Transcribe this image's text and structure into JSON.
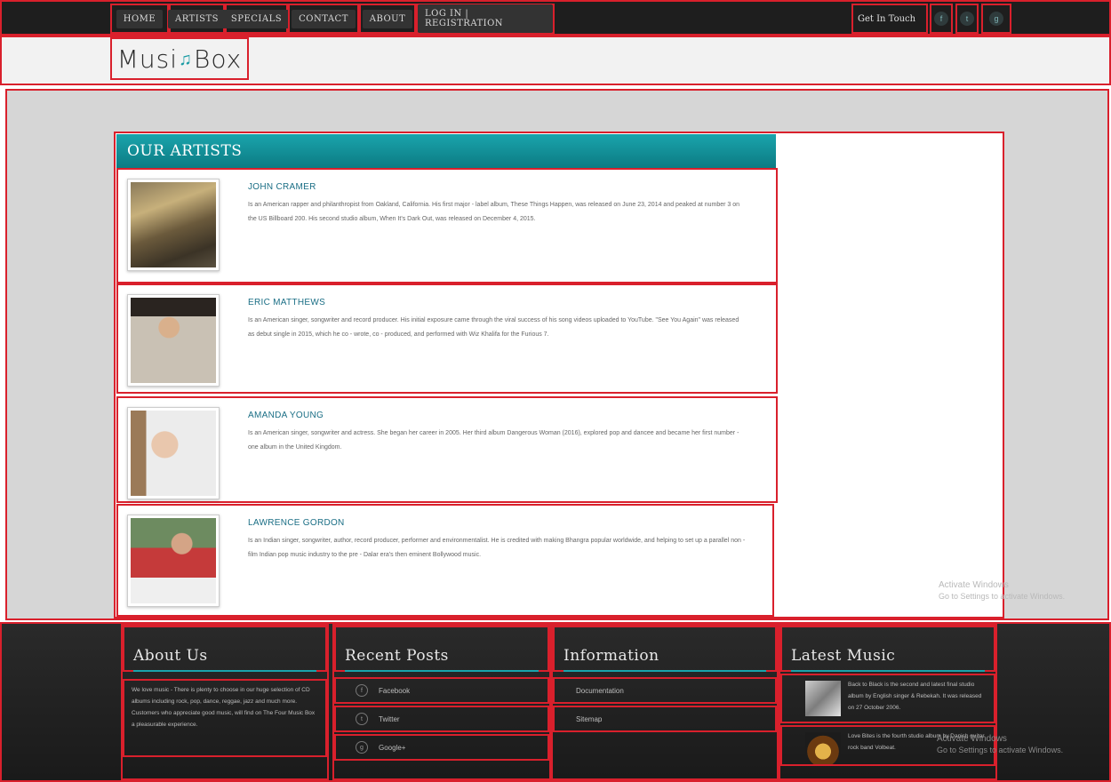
{
  "nav": {
    "items": [
      "Home",
      "Artists",
      "Specials",
      "Contact",
      "About",
      "Log In | Registration"
    ],
    "get_in_touch": "Get In Touch",
    "social_icons": [
      "facebook-icon",
      "twitter-icon",
      "google-plus-icon"
    ],
    "social_glyphs": [
      "f",
      "t",
      "g"
    ]
  },
  "logo": {
    "part1": "Musi",
    "note": "♫",
    "part2": "Box"
  },
  "artists_section": {
    "title": "Our Artists",
    "artists": [
      {
        "name": "JOHN CRAMER",
        "bio": "Is an American rapper and philanthropist from Oakland, California. His first major - label album, These Things Happen, was released on June 23, 2014 and peaked at number 3 on the US Billboard 200. His second studio album, When It's Dark Out, was released on December 4, 2015."
      },
      {
        "name": "ERIC MATTHEWS",
        "bio": "Is an American singer, songwriter and record producer. His initial exposure came through the viral success of his song videos uploaded to YouTube. \"See You Again\" was released as debut single in 2015, which he co - wrote, co - produced, and performed with Wiz Khalifa for the Furious 7."
      },
      {
        "name": "AMANDA YOUNG",
        "bio": "Is an American singer, songwriter and actress. She began her career in 2005. Her third album Dangerous Woman (2016), explored pop and dancee and became her first number - one album in the United Kingdom."
      },
      {
        "name": "LAWRENCE GORDON",
        "bio": "Is an Indian singer, songwriter, author, record producer, performer and environmentalist. He is credited with making Bhangra popular worldwide, and helping to set up a parallel non - film Indian pop music industry to the pre - Dalar era's then eminent Bollywood music."
      }
    ]
  },
  "watermark": {
    "line1": "Activate Windows",
    "line2": "Go to Settings to activate Windows."
  },
  "footer": {
    "about": {
      "title": "About Us",
      "text": "We love music - There is plenty to choose in our huge selection of CD albums including rock, pop, dance, reggae, jazz and much more. Customers who appreciate good music, will find on The Four Music Box a pleasurable experience."
    },
    "recent_posts": {
      "title": "Recent Posts",
      "items": [
        {
          "icon": "f",
          "label": "Facebook"
        },
        {
          "icon": "t",
          "label": "Twitter"
        },
        {
          "icon": "g",
          "label": "Google+"
        }
      ]
    },
    "information": {
      "title": "Information",
      "items": [
        "Documentation",
        "Sitemap"
      ]
    },
    "latest_music": {
      "title": "Latest Music",
      "items": [
        "Back to Black is the second and latest final studio album by English singer & Rebekah. It was released on 27 October 2006.",
        "Love Bites is the fourth studio album by Danish guitar rock band Volbeat."
      ]
    }
  }
}
